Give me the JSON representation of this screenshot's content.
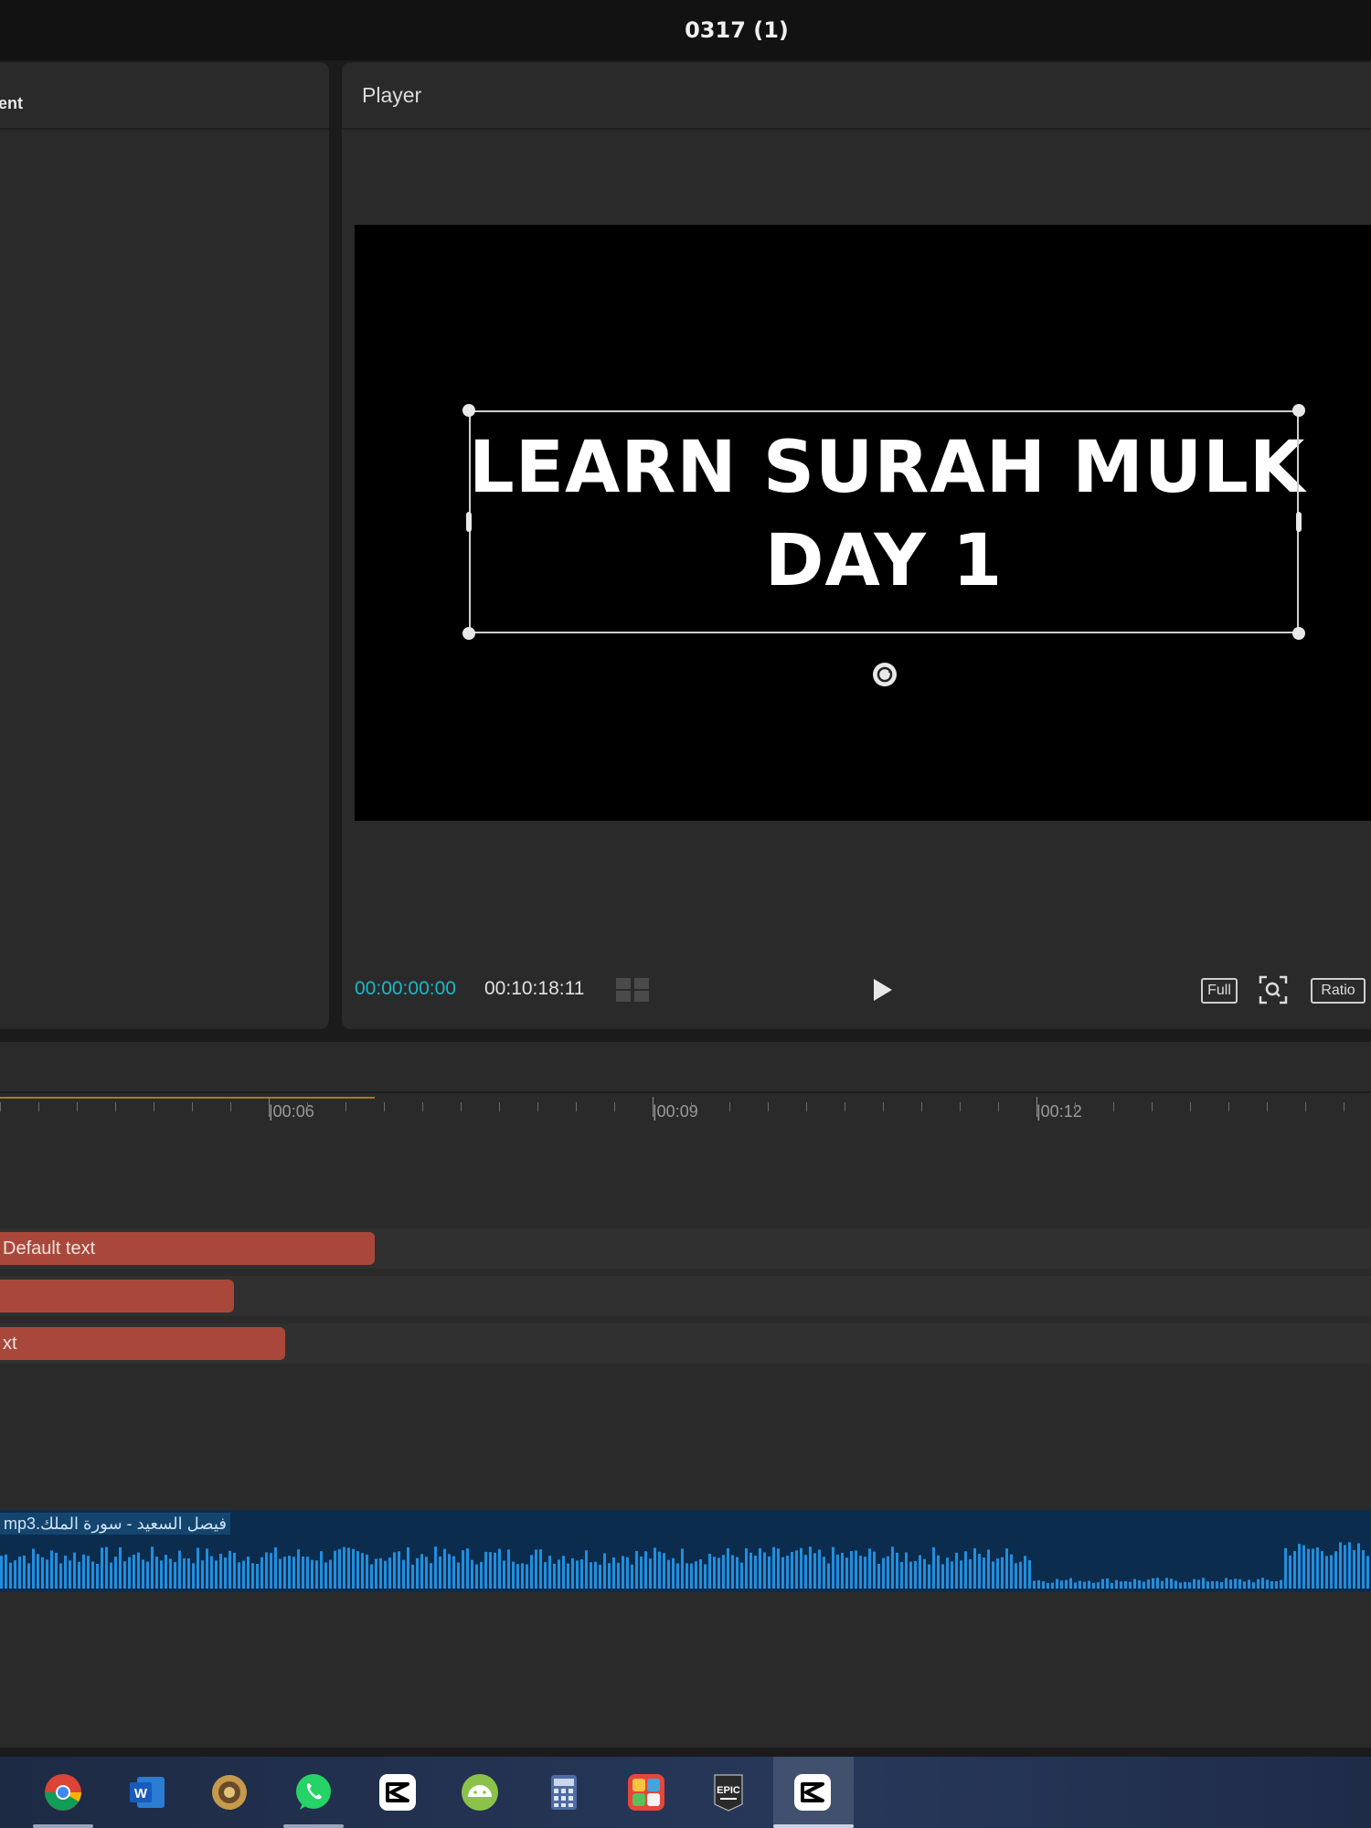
{
  "window": {
    "title": "0317 (1)"
  },
  "left_panel": {
    "title_fragment": "ent"
  },
  "player": {
    "title": "Player",
    "preview_text_line1": "LEARN SURAH MULK",
    "preview_text_line2": "DAY 1",
    "current_time": "00:00:00:00",
    "total_time": "00:10:18:11",
    "full_label": "Full",
    "ratio_label": "Ratio",
    "icons": [
      "grid-icon",
      "play-icon",
      "fit-to-screen-icon",
      "rotate-icon"
    ]
  },
  "timeline": {
    "ruler_labels": [
      "|00:06",
      "|00:09",
      "|00:12"
    ],
    "text_clips": [
      {
        "label": "Default text"
      },
      {
        "label": ""
      },
      {
        "label": "xt"
      }
    ],
    "audio_clip": {
      "label": "فيصل السعيد - سورة الملك.mp3"
    },
    "colors": {
      "text_clip": "#a9483a",
      "audio_clip": "#0c2c4d",
      "waveform": "#1f8fe0",
      "current_time": "#19b9c6"
    }
  },
  "taskbar": {
    "apps": [
      "chrome-icon",
      "word-icon",
      "app-icon",
      "whatsapp-icon",
      "capcut-icon",
      "android-icon",
      "calculator-icon",
      "game-icon",
      "epic-games-icon",
      "capcut-active-icon"
    ]
  }
}
